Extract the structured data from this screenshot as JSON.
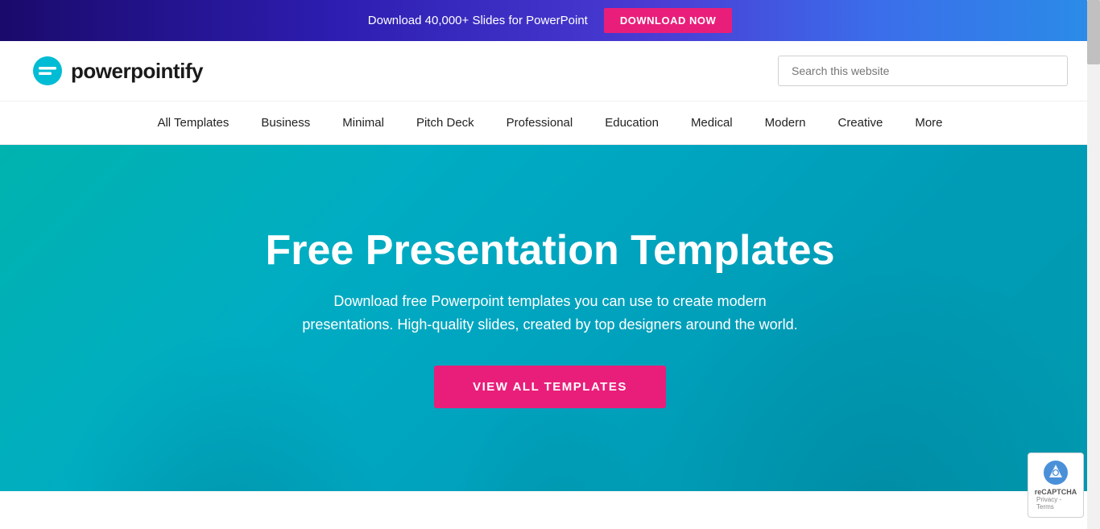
{
  "banner": {
    "text": "Download 40,000+ Slides for PowerPoint",
    "button_label": "DOWNLOAD NOW"
  },
  "header": {
    "logo_text": "powerpointify",
    "search_placeholder": "Search this website"
  },
  "nav": {
    "items": [
      {
        "label": "All Templates"
      },
      {
        "label": "Business"
      },
      {
        "label": "Minimal"
      },
      {
        "label": "Pitch Deck"
      },
      {
        "label": "Professional"
      },
      {
        "label": "Education"
      },
      {
        "label": "Medical"
      },
      {
        "label": "Modern"
      },
      {
        "label": "Creative"
      },
      {
        "label": "More"
      }
    ]
  },
  "hero": {
    "title": "Free Presentation Templates",
    "subtitle": "Download free Powerpoint templates you can use to create modern\npresentations. High-quality slides, created by top designers around the world.",
    "cta_label": "VIEW ALL TEMPLATES"
  },
  "recaptcha": {
    "line1": "reCAPTCHA",
    "line2": "Privacy - Terms"
  }
}
